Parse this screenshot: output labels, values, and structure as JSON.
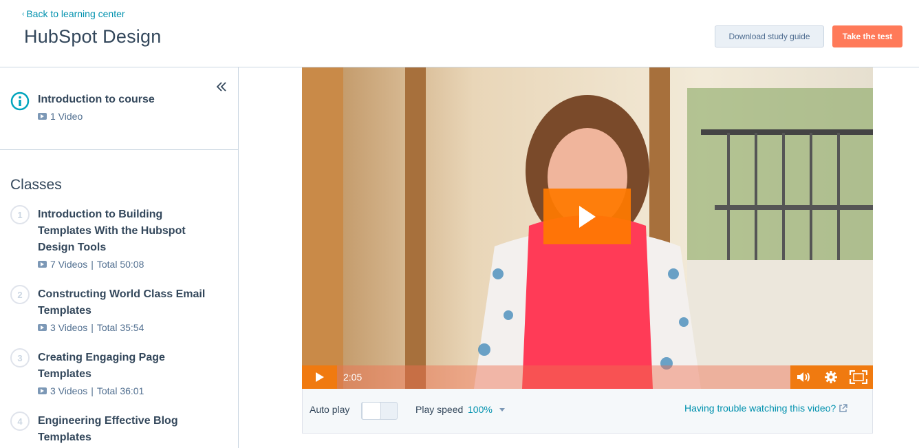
{
  "header": {
    "back_label": "Back to learning center",
    "title": "HubSpot Design",
    "download_label": "Download study guide",
    "test_label": "Take the test"
  },
  "sidebar": {
    "intro": {
      "title": "Introduction to course",
      "videos": "1 Video"
    },
    "classes_heading": "Classes",
    "classes": [
      {
        "num": "1",
        "title": "Introduction to Building Templates With the Hubspot Design Tools",
        "videos": "7 Videos",
        "total": "Total 50:08"
      },
      {
        "num": "2",
        "title": "Constructing World Class Email Templates",
        "videos": "3 Videos",
        "total": "Total 35:54"
      },
      {
        "num": "3",
        "title": "Creating Engaging Page Templates",
        "videos": "3 Videos",
        "total": "Total 36:01"
      },
      {
        "num": "4",
        "title": "Engineering Effective Blog Templates",
        "videos": "",
        "total": ""
      }
    ]
  },
  "player": {
    "time": "2:05",
    "accent": "#f07a10"
  },
  "settings": {
    "autoplay_label": "Auto play",
    "speed_label": "Play speed",
    "speed_value": "100%",
    "trouble_label": "Having trouble watching this video?"
  }
}
